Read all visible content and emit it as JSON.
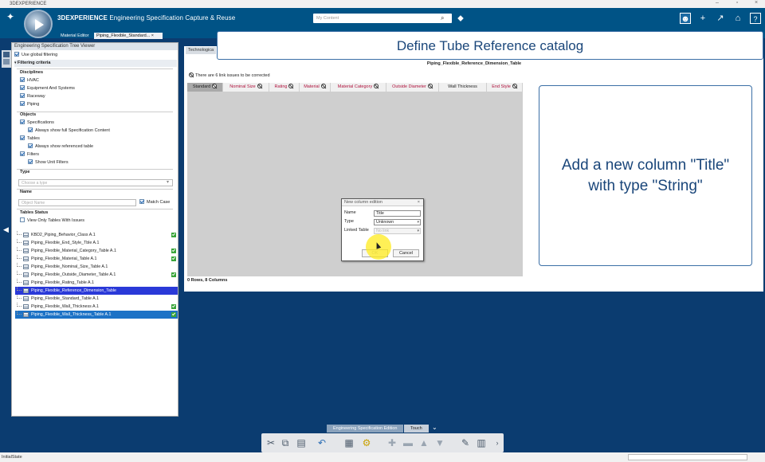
{
  "window": {
    "title": "3DEXPERIENCE"
  },
  "header": {
    "brand_bold": "3DEXPERIENCE",
    "brand_rest": " Engineering Specification Capture & Reuse",
    "search_placeholder": "My Content"
  },
  "tabs": [
    {
      "label": "Material Editor"
    },
    {
      "label": "Piping_Flexible_Standard...",
      "close": "×"
    }
  ],
  "banner": {
    "text": "Define Tube Reference catalog"
  },
  "left_panel": {
    "title": "Engineering Specification Tree Viewer",
    "use_global_filtering": "Use global filtering",
    "filtering_criteria": "Filtering criteria",
    "disciplines_title": "Disciplines",
    "disciplines": [
      "HVAC",
      "Equipment And Systems",
      "Raceway",
      "Piping"
    ],
    "objects_title": "Objects",
    "specifications": "Specifications",
    "always_show_full_spec": "Always show full Specification Content",
    "tables": "Tables",
    "always_show_referenced": "Always show referenced table",
    "filters": "Filters",
    "show_unit_filters": "Show Unit Filters",
    "type_title": "Type",
    "type_placeholder": "Choose a type",
    "name_title": "Name",
    "name_placeholder": "Object Name",
    "match_case": "Match Case",
    "tables_status_title": "Tables Status",
    "view_only_issues": "View Only Tables With Issues",
    "table_items": [
      "KBD2_Piping_Behavior_Class A.1",
      "Piping_Flexible_End_Style_Tble A.1",
      "Piping_Flexible_Material_Category_Table A.1",
      "Piping_Flexible_Material_Table A.1",
      "Piping_Flexible_Nominal_Size_Table A.1",
      "Piping_Flexible_Outside_Diameter_Table A.1",
      "Piping_Flexible_Rating_Table A.1",
      "Piping_Flexible_Reference_Dimension_Table",
      "Piping_Flexible_Standard_Table A.1",
      "Piping_Flexible_Wall_Thickness A.1",
      "Piping_Flexible_Wall_Thickness_Table A.1"
    ]
  },
  "editor": {
    "tab_label": "Technologica",
    "table_title": "Piping_Flexible_Reference_Dimension_Table",
    "issues_text": "There are 6 link issues to be corrected",
    "columns": [
      "Standard",
      "Nominal Size",
      "Rating",
      "Material",
      "Material Category",
      "Outside Diameter",
      "Wall Thickness",
      "End Style"
    ],
    "row_count": "0 Rows, 8 Columns"
  },
  "dialog": {
    "title": "New column edition",
    "close": "×",
    "name_label": "Name",
    "name_value": "Title",
    "type_label": "Type",
    "type_value": "Unknown",
    "linked_label": "Linked Table",
    "linked_value": "No link",
    "ok": "OK",
    "cancel": "Cancel"
  },
  "note": {
    "text": "Add a new column \"Title\" with type \"String\""
  },
  "bottom_tabs": [
    {
      "label": "Engineering Specification Edition"
    },
    {
      "label": "Touch"
    }
  ],
  "status": {
    "text": "InitialState"
  }
}
